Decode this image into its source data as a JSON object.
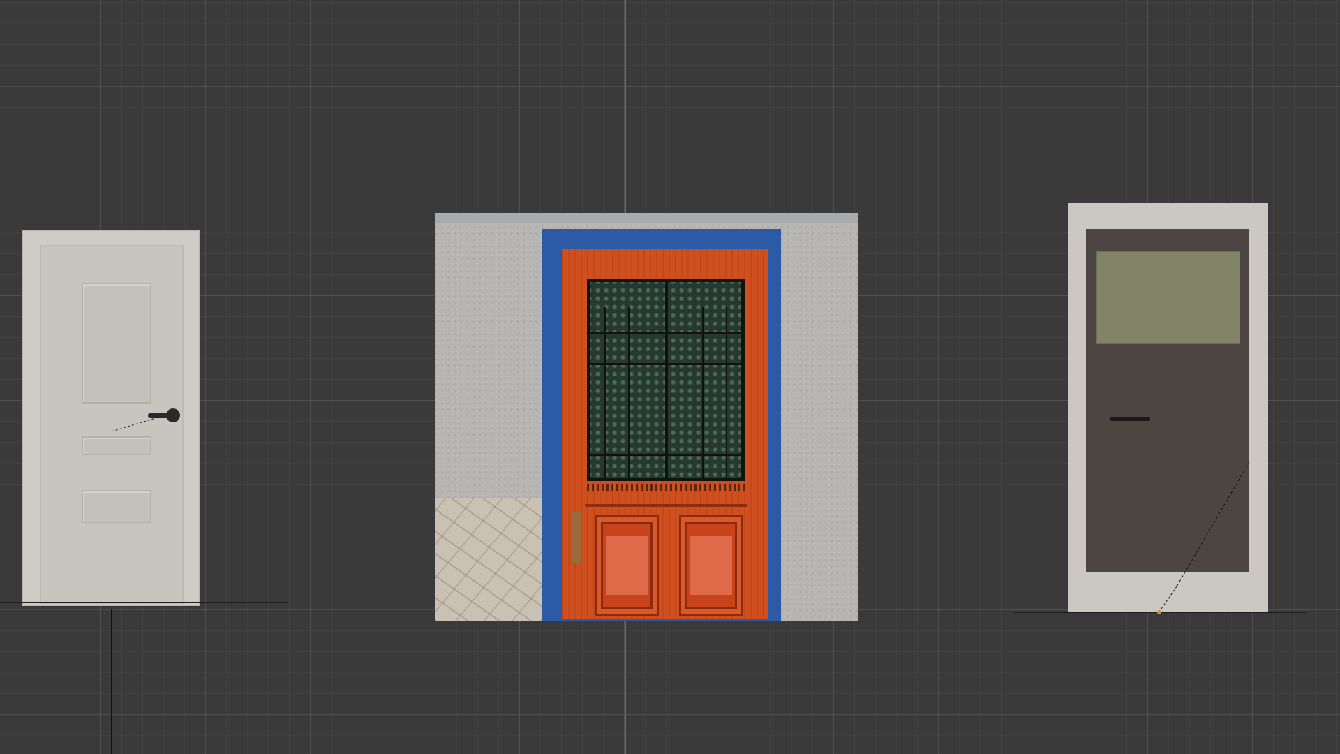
{
  "viewport": {
    "background_color": "#3a3a3a",
    "grid_color": "#5f5f5f",
    "axis_z_color": "#4d6fa8",
    "axis_x_color": "#7d9a2e"
  },
  "objects": [
    {
      "name": "white-paneled-door",
      "color": "#cfccc6",
      "handle": "black-lever-handle"
    },
    {
      "name": "red-door-with-wrought-iron-glass",
      "frame_color": "#2d5aa6",
      "door_color": "#cf4f1f",
      "wall_color": "#b7b5b2"
    },
    {
      "name": "dark-door-with-window",
      "frame_color": "#cbc8c1",
      "leaf_color": "#4d4542",
      "window_color": "#828468"
    }
  ]
}
